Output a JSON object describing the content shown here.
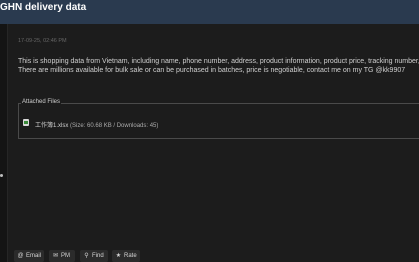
{
  "header": {
    "title": "GHN delivery data"
  },
  "post": {
    "timestamp": "17-09-25, 02:46 PM",
    "message_lines": [
      "This is shopping data from Vietnam, including name, phone number, address, product information, product price, tracking number,",
      " There are millions available for bulk sale or can be purchased in batches, price is negotiable, contact me on my TG @kk9907"
    ],
    "attachments": {
      "legend": "Attached Files",
      "file_name": "工作簿1.xlsx",
      "file_meta": "(Size: 60.68 KB / Downloads: 45)",
      "file_icon": "xlsx-file-icon"
    }
  },
  "actions": {
    "email": {
      "label": "Email",
      "icon": "at-icon"
    },
    "pm": {
      "label": "PM",
      "icon": "envelope-icon"
    },
    "find": {
      "label": "Find",
      "icon": "search-icon"
    },
    "rate": {
      "label": "Rate",
      "icon": "star-icon"
    }
  },
  "colors": {
    "header_bg": "#2a3a4f",
    "page_bg": "#1a1a1a",
    "text": "#cfcfcf",
    "button_bg": "#2b2b2b"
  }
}
